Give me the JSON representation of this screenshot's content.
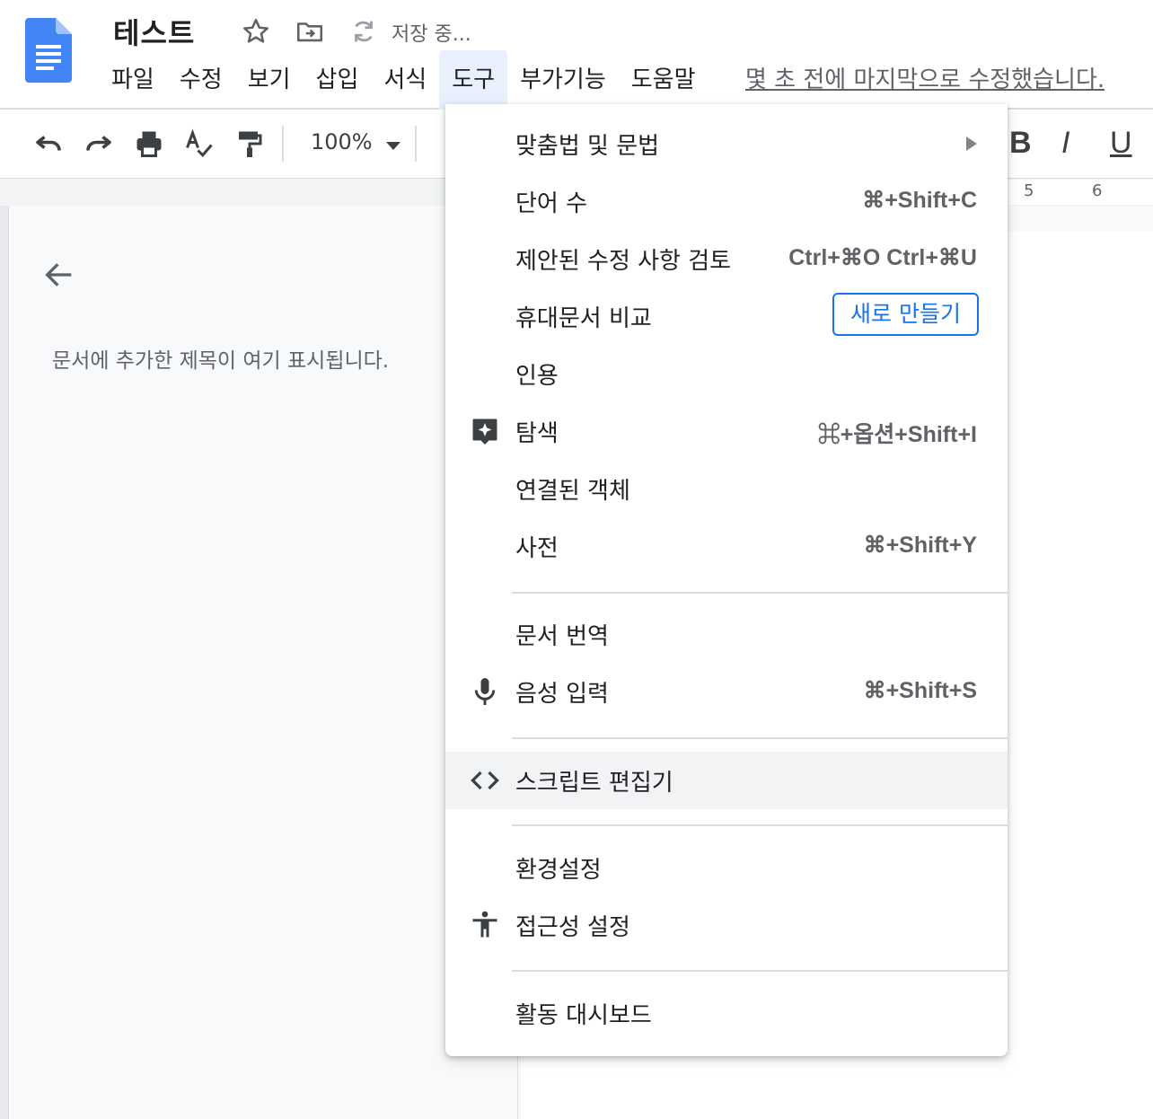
{
  "header": {
    "title": "테스트",
    "saving_status": "저장 중...",
    "menus": [
      "파일",
      "수정",
      "보기",
      "삽입",
      "서식",
      "도구",
      "부가기능",
      "도움말"
    ],
    "active_menu_index": 5,
    "last_edit": "몇 초 전에 마지막으로 수정했습니다.",
    "brand_color": "#4285f4"
  },
  "toolbar": {
    "zoom": "100%",
    "bold": "B",
    "italic": "I",
    "underline": "U"
  },
  "ruler": {
    "numbers": [
      "5",
      "6"
    ]
  },
  "outline": {
    "hint": "문서에 추가한 제목이 여기 표시됩니다."
  },
  "tools_menu": {
    "items": [
      {
        "label": "맞춤법 및 문법",
        "shortcut": "",
        "submenu": true,
        "icon": ""
      },
      {
        "label": "단어 수",
        "shortcut": "⌘+Shift+C",
        "icon": ""
      },
      {
        "label": "제안된 수정 사항 검토",
        "shortcut": "Ctrl+⌘O Ctrl+⌘U",
        "icon": ""
      },
      {
        "label": "휴대문서 비교",
        "button": "새로 만들기",
        "icon": ""
      },
      {
        "label": "인용",
        "shortcut": "",
        "icon": ""
      },
      {
        "label": "탐색",
        "shortcut": "⌘+옵션+Shift+I",
        "icon": "explore-icon"
      },
      {
        "label": "연결된 객체",
        "shortcut": "",
        "icon": ""
      },
      {
        "label": "사전",
        "shortcut": "⌘+Shift+Y",
        "icon": ""
      },
      {
        "label": "문서 번역",
        "shortcut": "",
        "icon": ""
      },
      {
        "label": "음성 입력",
        "shortcut": "⌘+Shift+S",
        "icon": "microphone-icon"
      },
      {
        "label": "스크립트 편집기",
        "shortcut": "",
        "icon": "code-icon",
        "highlighted": true
      },
      {
        "label": "환경설정",
        "shortcut": "",
        "icon": ""
      },
      {
        "label": "접근성 설정",
        "shortcut": "",
        "icon": "accessibility-icon"
      },
      {
        "label": "활동 대시보드",
        "shortcut": "",
        "icon": ""
      }
    ]
  }
}
